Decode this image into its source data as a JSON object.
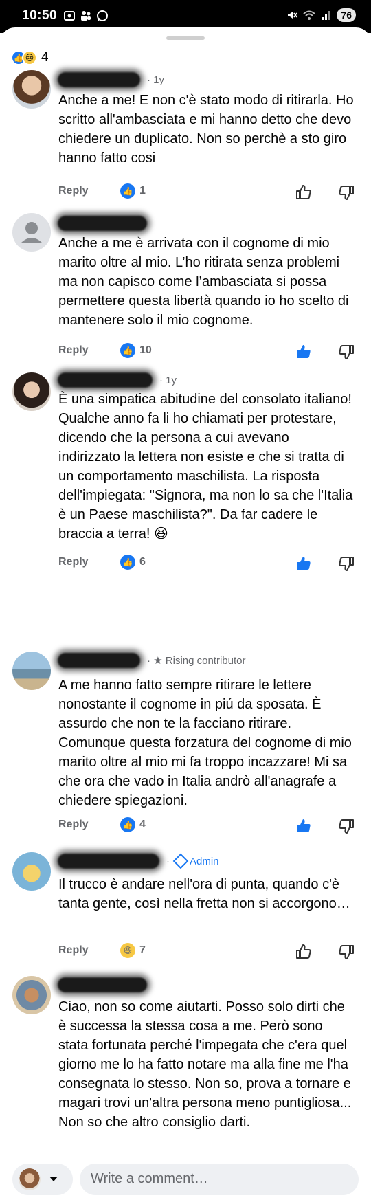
{
  "status": {
    "time": "10:50",
    "battery": "76"
  },
  "reactions": {
    "count": "4"
  },
  "comments": [
    {
      "meta": "· 1y",
      "badge": "",
      "text": "Anche a me! E non c'è stato modo di ritirarla. Ho scritto all'ambasciata e mi hanno detto che devo chiedere un duplicato. Non so perchè a sto giro hanno fatto cosi",
      "reply": "Reply",
      "reaction_count": "1",
      "reaction": "like",
      "liked": false
    },
    {
      "meta": "",
      "badge": "",
      "text": "Anche a me è arrivata con il cognome di mio marito oltre al mio. L’ho ritirata senza problemi ma non capisco come l’ambasciata si possa permettere questa libertà quando io ho scelto di mantenere solo il mio cognome.",
      "reply": "Reply",
      "reaction_count": "10",
      "reaction": "like",
      "liked": true
    },
    {
      "meta": "· 1y",
      "badge": "",
      "text": "È una simpatica abitudine del consolato italiano! Qualche anno fa li ho chiamati per protestare, dicendo che la persona a cui avevano indirizzato la lettera non esiste e che si tratta di un comportamento maschilista. La risposta dell'impiegata: \"Signora, ma non lo sa che l'Italia è un Paese maschilista?\". Da far cadere le braccia a terra! 😆",
      "reply": "Reply",
      "reaction_count": "6",
      "reaction": "like",
      "liked": true
    },
    {
      "meta": "· ★ Rising contributor",
      "badge": "",
      "text": "A me hanno fatto sempre ritirare le lettere nonostante il cognome in piú da sposata. È assurdo che non te la facciano ritirare. Comunque questa forzatura del cognome di mio marito oltre al mio mi fa troppo incazzare! Mi sa che ora che vado in Italia andrò all'anagrafe a chiedere spiegazioni.",
      "reply": "Reply",
      "reaction_count": "4",
      "reaction": "like",
      "liked": true
    },
    {
      "meta": "·",
      "badge": "Admin",
      "text": "Il trucco è andare nell'ora di punta, quando c'è tanta gente, così nella fretta non si accorgono…",
      "reply": "Reply",
      "reaction_count": "7",
      "reaction": "haha",
      "liked": false
    },
    {
      "meta": "",
      "badge": "",
      "text": "Ciao, non so come aiutarti. Posso solo dirti che è successa la stessa cosa a me. Però sono stata  fortunata perché l'impegata che c'era quel giorno me lo ha fatto notare ma alla fine me l'ha consegnata lo stesso. Non so, prova a tornare e magari trovi un'altra persona meno puntigliosa... Non so che altro consiglio darti.",
      "reply": "",
      "reaction_count": "",
      "reaction": "",
      "liked": false
    }
  ],
  "composer": {
    "placeholder": "Write a comment…"
  },
  "colors": {
    "accent": "#1877f2",
    "muted": "#65676b"
  }
}
